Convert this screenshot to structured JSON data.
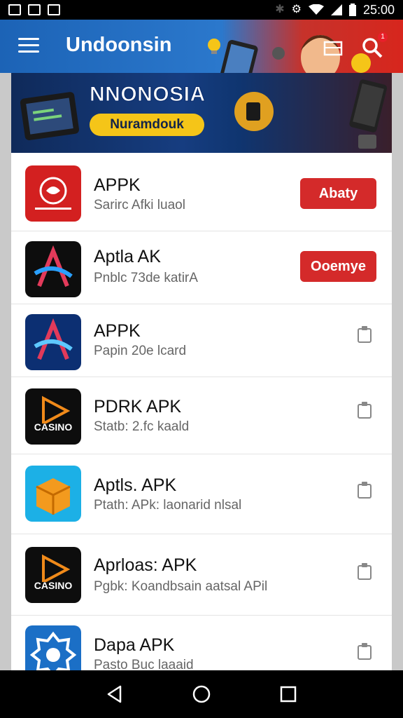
{
  "status_bar": {
    "time": "25:00",
    "icons": [
      "gallery-icon",
      "gallery-icon",
      "gallery-icon",
      "bluetooth-icon",
      "alarm-icon",
      "wifi-icon",
      "signal-icon",
      "battery-icon"
    ]
  },
  "app_bar": {
    "title": "Undoonsin",
    "notification_count": "1"
  },
  "banner": {
    "title": "NNONOSIA",
    "button_label": "Nuramdouk"
  },
  "apps": [
    {
      "name": "APPK",
      "subtitle": "Sarirc Afki luaol",
      "action": "Abaty",
      "icon": "red-seal-icon",
      "icon_bg": "#d32020"
    },
    {
      "name": "Aptla AK",
      "subtitle": "Pnblc 73de katirA",
      "action": "Ooemye",
      "icon": "black-arrow-icon",
      "icon_bg": "#0d0d0d"
    },
    {
      "name": "APPK",
      "subtitle": "Papin 20e lcard",
      "action": "",
      "icon": "blue-arrow-icon",
      "icon_bg": "#0c2f72"
    },
    {
      "name": "PDRK APK",
      "subtitle": "Statb: 2.fc kaald",
      "action": "",
      "icon": "casino-icon",
      "icon_bg": "#0d0d0d"
    },
    {
      "name": "Aptls. APK",
      "subtitle": "Ptath: APk: laonarid nlsal",
      "action": "",
      "icon": "box-icon",
      "icon_bg": "#1cb0e6"
    },
    {
      "name": "Aprloas: APK",
      "subtitle": "Pgbk: Koandbsain aatsal APil",
      "action": "",
      "icon": "casino-icon",
      "icon_bg": "#0d0d0d"
    },
    {
      "name": "Dapa APK",
      "subtitle": "Pasto Buc laaaid",
      "action": "",
      "icon": "gear-icon",
      "icon_bg": "#1b6fc6"
    }
  ],
  "colors": {
    "accent_red": "#d42a2a",
    "app_bar_blue": "#1c63b6",
    "banner_yellow": "#f5c518"
  }
}
